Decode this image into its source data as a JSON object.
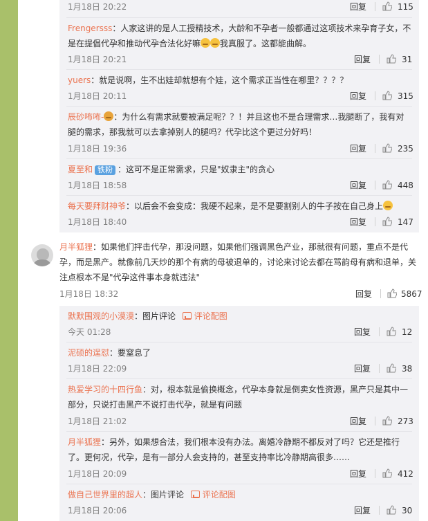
{
  "ui": {
    "reply_label": "回复",
    "pic_comment_label": "图片评论",
    "pic_config_label": "评论配图"
  },
  "replies_a": [
    {
      "user": "",
      "text": "",
      "time": "1月18日 20:22",
      "likes": "115"
    },
    {
      "user": "Frengersss",
      "text": "：人家这讲的是人工授精技术，大龄和不孕者一般都通过这项技术来孕育子女，不是在提倡代孕和推动代孕合法化好嘛",
      "text_after": "我真服了。这都能曲解。",
      "time": "1月18日 20:21",
      "likes": "31"
    },
    {
      "user": "yuers",
      "text": "：就是说啊，生不出娃却就想有个娃，这个需求正当性在哪里？？？？",
      "time": "1月18日 20:11",
      "likes": "315"
    },
    {
      "user": "辰砂咘咘-",
      "text": "：为什么有需求就要被满足呢？？！并且这也不是合理需求…我腿断了，我有对腿的需求，那我就可以去拿掉别人的腿吗？代孕比这个更过分好吗！",
      "time": "1月18日 19:36",
      "likes": "235"
    },
    {
      "user": "夏至和",
      "badge": "铁粉",
      "text": "：这可不是正常需求，只是\"奴隶主\"的贪心",
      "time": "1月18日 18:58",
      "likes": "448"
    },
    {
      "user": "每天要拜财神爷",
      "text": "：以后会不会变成：我硬不起来，是不是要割别人的牛子按在自己身上",
      "time": "1月18日 18:40",
      "likes": "147"
    }
  ],
  "main_comment": {
    "user": "月半狐狸",
    "text": "：如果他们抨击代孕，那没问题，如果他们强调黑色产业，那就很有问题，重点不是代孕，而是黑产。就像前几天炒的那个有病的母被退单的，讨论来讨论去都在骂韵母有病和退单，关注点根本不是\"代孕这件事本身就违法\"",
    "time": "1月18日 18:32",
    "likes": "5867"
  },
  "replies_b": [
    {
      "user": "默默围观的小漠漠",
      "pic": true,
      "time": "今天 01:28",
      "likes": "12"
    },
    {
      "user": "泥硕的逞怼",
      "text": "：要窒息了",
      "time": "1月18日 22:09",
      "likes": "38"
    },
    {
      "user": "热爱学习的十四行鱼",
      "text": "：对，根本就是偷换概念，代孕本身就是倒卖女性资源，黑产只是其中一部分，只说打击黑产不说打击代孕，就是有问题",
      "time": "1月18日 21:02",
      "likes": "273"
    },
    {
      "user": "月半狐狸",
      "text": "：另外，如果想合法，我们根本没有办法。离婚冷静期不都反对了吗？它还是推行了。更何况，代孕，是有一部分人会支持的，甚至支持率比冷静期高很多……",
      "time": "1月18日 20:09",
      "likes": "412"
    },
    {
      "user": "做自己世界里的超人",
      "pic": true,
      "time": "1月18日 20:06",
      "likes": "30"
    }
  ]
}
